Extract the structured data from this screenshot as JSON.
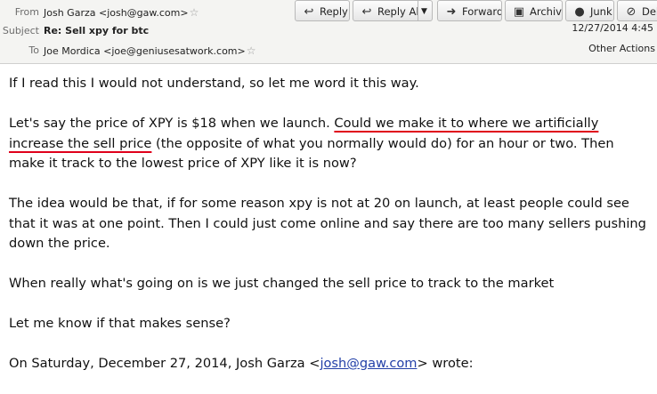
{
  "header": {
    "from_label": "From",
    "from_value": "Josh Garza <josh@gaw.com>",
    "subject_label": "Subject",
    "subject_value": "Re: Sell xpy for btc",
    "to_label": "To",
    "to_value": "Joe Mordica <joe@geniusesatwork.com>",
    "date": "12/27/2014 4:45",
    "other_actions": "Other Actions"
  },
  "toolbar": {
    "reply": "Reply",
    "reply_all": "Reply All",
    "forward": "Forward",
    "archive": "Archive",
    "junk": "Junk",
    "delete": "Dele"
  },
  "body": {
    "p1": "If I read this I would not understand, so let me word it this way.",
    "p2_pre": "Let's say the price of XPY is $18 when we launch. ",
    "p2_highlight": "Could we make it to where we artificially increase the sell price",
    "p2_post": " (the opposite of what you normally would do) for an hour or two. Then make it track to the lowest price of XPY like it is now?",
    "p3": "The idea would be that, if for some reason xpy is not at 20 on launch, at least people could see that it was at one point. Then I could just come online and say there are too many sellers pushing down the price.",
    "p4": "When really what's going on is we just changed the sell price to track to the market",
    "p5": "Let me know if that makes sense?",
    "quote_pre": "On Saturday, December 27, 2014, Josh Garza <",
    "quote_link": "josh@gaw.com",
    "quote_post": "> wrote:"
  }
}
